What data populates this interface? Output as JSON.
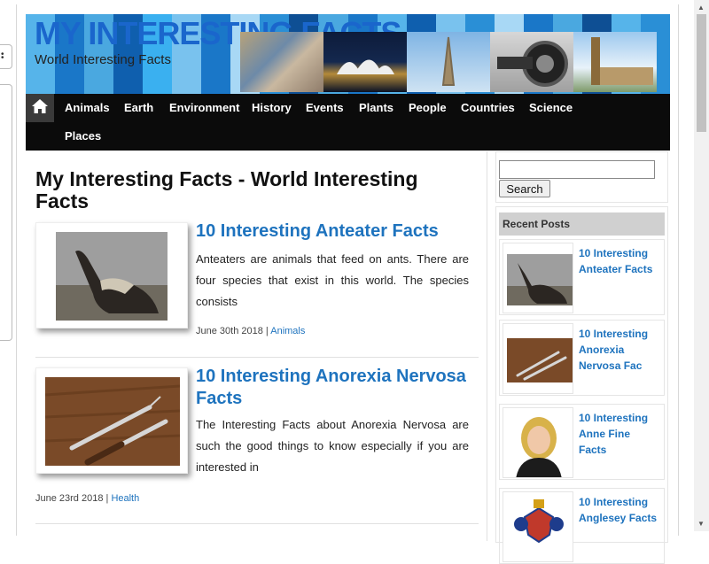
{
  "site": {
    "title": "MY INTERESTING FACTS",
    "tagline": "World Interesting Facts"
  },
  "nav": {
    "items": [
      "Animals",
      "Earth",
      "Environment",
      "History",
      "Events",
      "Plants",
      "People",
      "Countries",
      "Science",
      "Places"
    ]
  },
  "main": {
    "page_title": "My Interesting Facts - World Interesting Facts",
    "posts": [
      {
        "title": "10 Interesting Anteater Facts",
        "excerpt": "Anteaters are animals that feed on ants. There are four species that exist in this world. The species consists",
        "date": "June 30th 2018",
        "separator": " | ",
        "category": "Animals"
      },
      {
        "title": "10 Interesting Anorexia Nervosa Facts",
        "excerpt": "The Interesting Facts about Anorexia Nervosa are such the good things to know especially if you are interested in",
        "date": "June 23rd 2018",
        "separator": " | ",
        "category": "Health"
      }
    ]
  },
  "sidebar": {
    "search_button": "Search",
    "search_value": "",
    "recent_heading": "Recent Posts",
    "recent_posts": [
      "10 Interesting Anteater Facts",
      "10 Interesting Anorexia Nervosa Fac",
      "10 Interesting Anne Fine Facts",
      "10 Interesting Anglesey Facts"
    ]
  },
  "colors": {
    "link": "#1e73be",
    "nav_bg": "#0b0b0b",
    "header_blue": "#4aa8e0"
  },
  "icons": [
    "home-icon",
    "scroll-up-icon",
    "scroll-down-icon"
  ]
}
